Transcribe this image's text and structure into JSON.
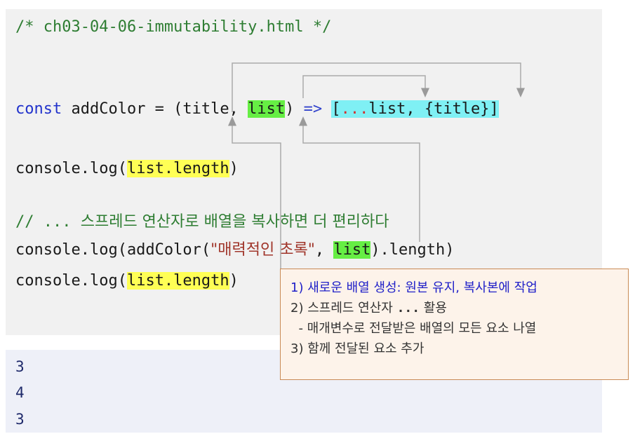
{
  "code": {
    "file_comment": "/* ch03-04-06-immutability.html */",
    "line_const": {
      "kw": "const",
      "name": " addColor = (title, ",
      "param_list": "list",
      "close": ")",
      "arrow": " => ",
      "body_open": "[",
      "spread": "...",
      "body_rest": "list, {title}]"
    },
    "line_log1": {
      "pre": "console.log(",
      "hl": "list.length",
      "post": ")"
    },
    "comment_spread": {
      "prefix": "// ... ",
      "text": "스프레드 연산자로 배열을 복사하면 더 편리하다"
    },
    "line_log2": {
      "pre": "console.log(addColor(",
      "str": "\"매력적인 초록\"",
      "mid": ", ",
      "hl": "list",
      "post": ").length)"
    },
    "line_log3": {
      "pre": "console.log(",
      "hl": "list.length",
      "post": ")"
    }
  },
  "output": [
    "3",
    "4",
    "3"
  ],
  "note": {
    "line1": "1) 새로운 배열 생성: 원본 유지, 복사본에 작업",
    "line2_pre": "2) 스프레드 연산자 ",
    "line2_code": "...",
    "line2_post": " 활용",
    "line3": "  - 매개변수로 전달받은 배열의 모든 요소 나열",
    "line4": "3) 함께 전달된 요소 추가"
  },
  "colors": {
    "highlight_green": "#66ee44",
    "highlight_yellow": "#ffff55",
    "highlight_cyan": "#7ff0f4",
    "note_border": "#c98a55"
  }
}
